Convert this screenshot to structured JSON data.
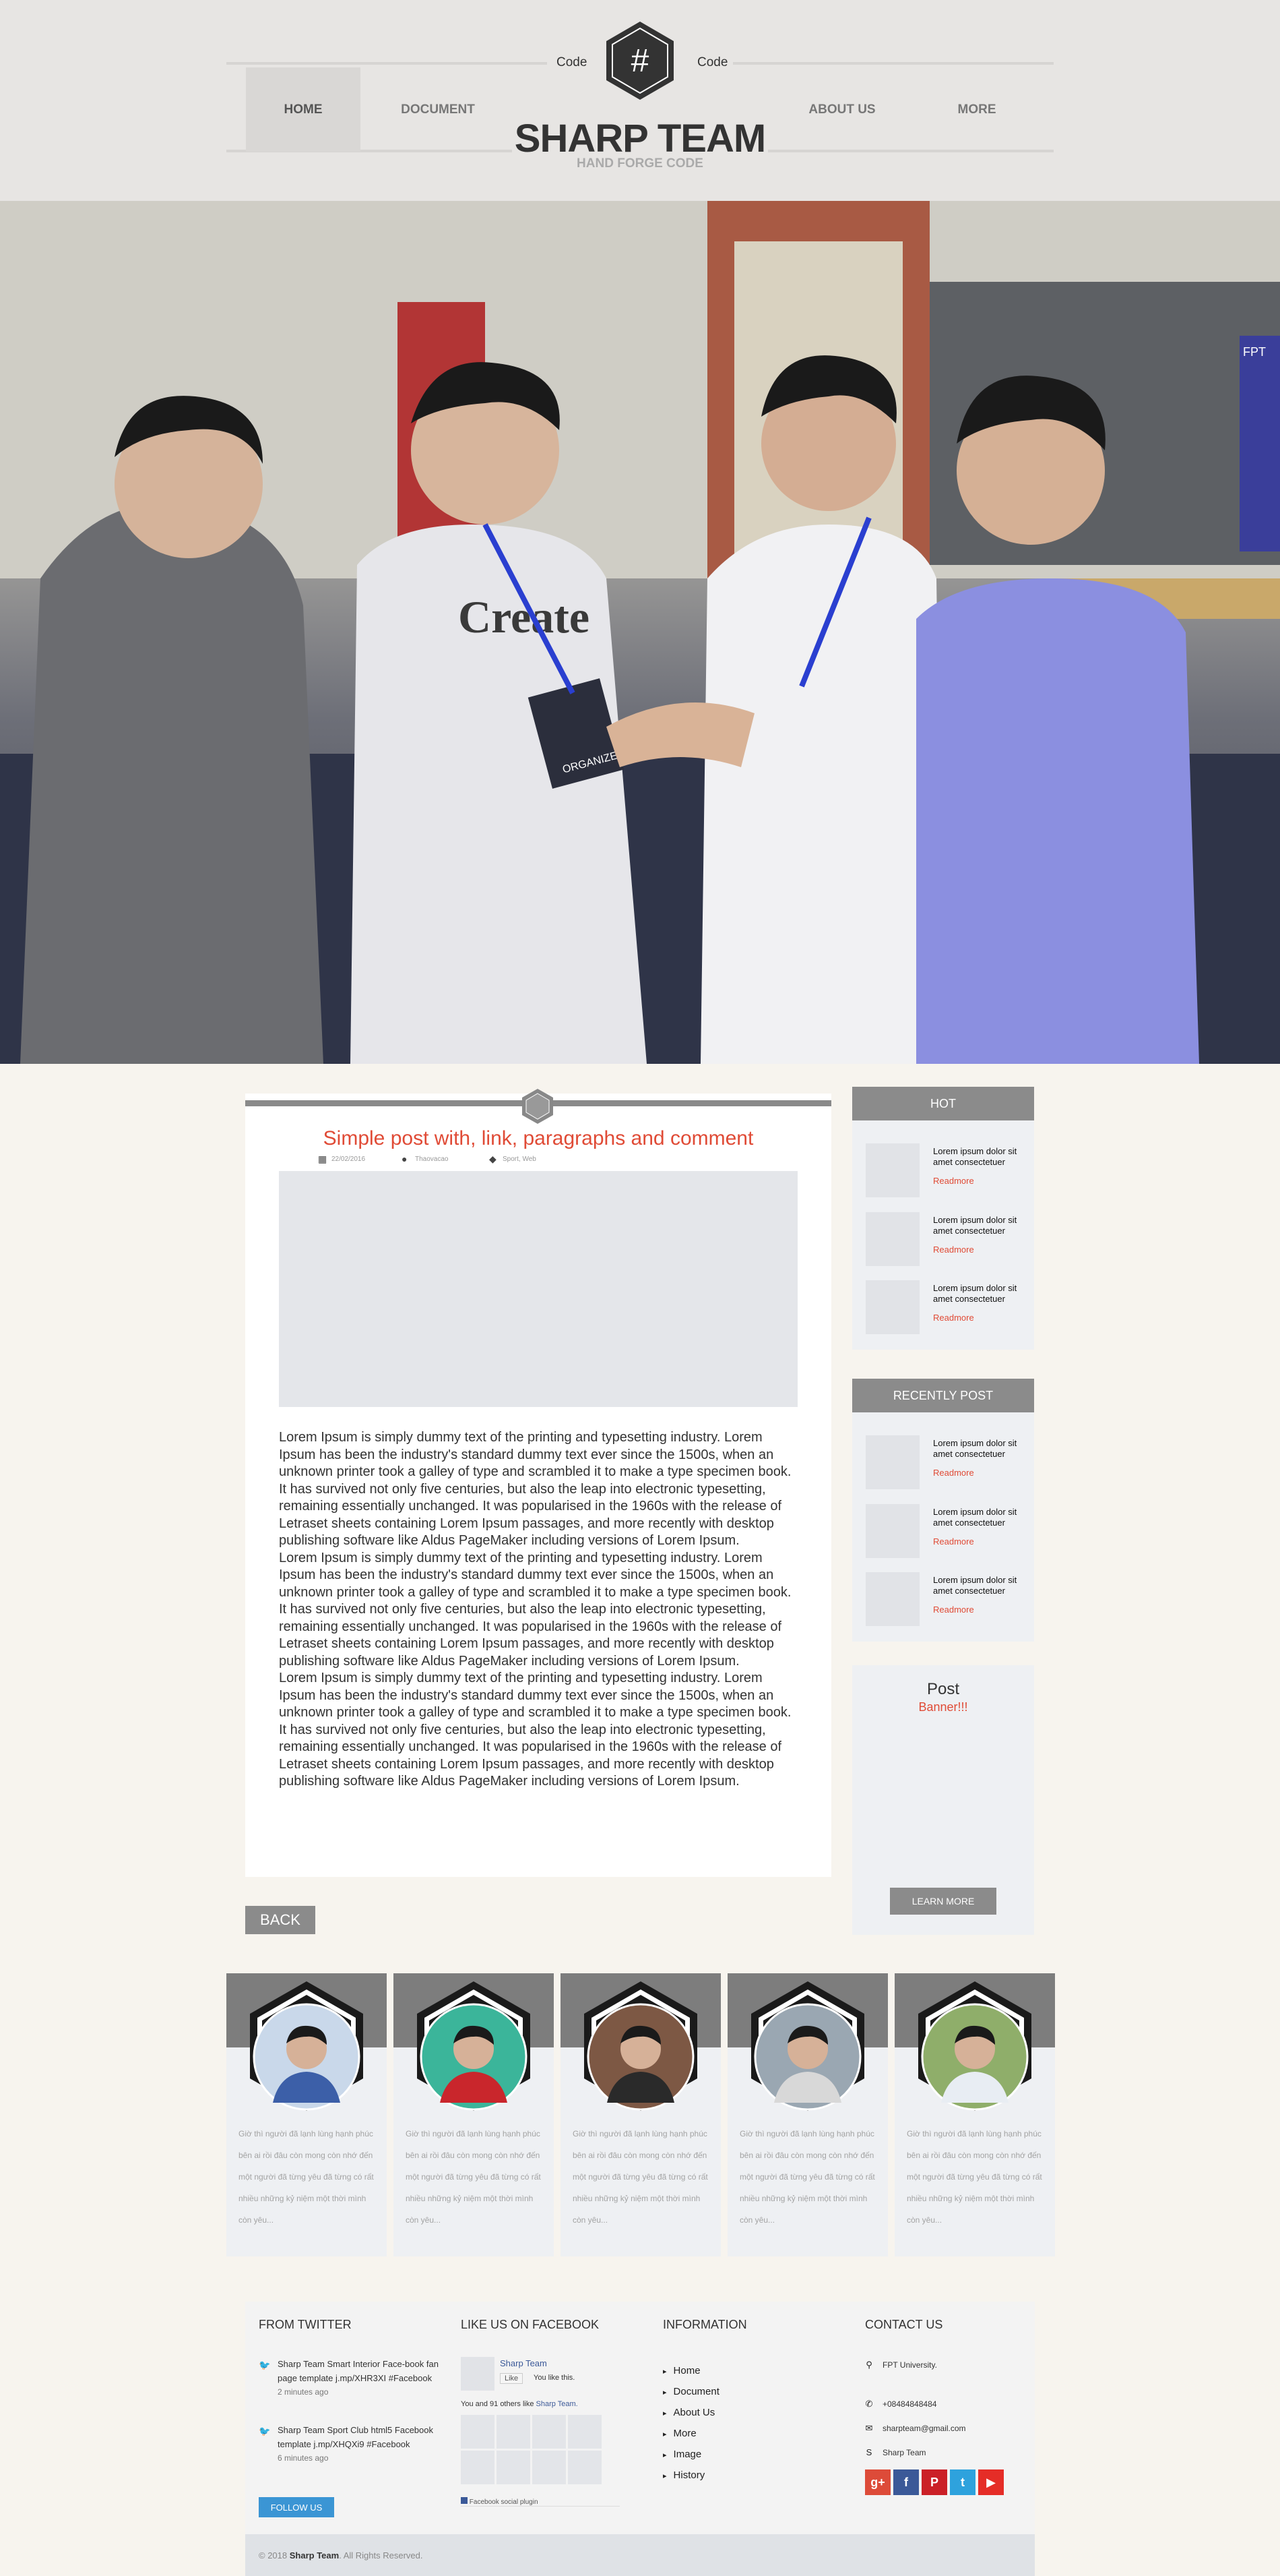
{
  "header": {
    "code_left": "Code",
    "code_right": "Code",
    "logo_symbol": "#",
    "brand": "SHARP TEAM",
    "tagline": "HAND FORGE CODE",
    "nav": [
      "HOME",
      "DOCUMENT",
      "ABOUT US",
      "MORE"
    ]
  },
  "hero": {
    "badge_text": "ORGANIZER",
    "shirt_text": "Create",
    "banner_text": "FPT",
    "slide_count": 3,
    "active_slide": 2
  },
  "post": {
    "title": "Simple post with, link,  paragraphs and comment",
    "date": "22/02/2016",
    "author": "Thaovacao",
    "tags": "Sport, Web",
    "paragraphs": [
      "Lorem Ipsum is simply dummy text of the printing and typesetting industry. Lorem Ipsum has been the industry's standard dummy text ever since the 1500s, when an unknown printer took a galley of type and scrambled it to make a type specimen book. It has survived not only five centuries, but also the leap into electronic typesetting, remaining essentially unchanged. It was popularised in the 1960s with the release of Letraset sheets containing Lorem Ipsum passages, and more recently with desktop publishing software like Aldus PageMaker including versions of Lorem Ipsum.",
      "Lorem Ipsum is simply dummy text of the printing and typesetting industry. Lorem Ipsum has been the industry's standard dummy text ever since the 1500s, when an unknown printer took a galley of type and scrambled it to make a type specimen book. It has survived not only five centuries, but also the leap into electronic typesetting, remaining essentially unchanged. It was popularised in the 1960s with the release of Letraset sheets containing Lorem Ipsum passages, and more recently with desktop publishing software like Aldus PageMaker including versions of Lorem Ipsum.",
      "Lorem Ipsum is simply dummy text of the printing and typesetting industry. Lorem Ipsum has been the industry's standard dummy text ever since the 1500s, when an unknown printer took a galley of type and scrambled it to make a type specimen book. It has survived not only five centuries, but also the leap into electronic typesetting, remaining essentially unchanged. It was popularised in the 1960s with the release of Letraset sheets containing Lorem Ipsum passages, and more recently with desktop publishing software like Aldus PageMaker including versions of Lorem Ipsum."
    ],
    "back_label": "BACK"
  },
  "sidebar": {
    "hot": {
      "title": "HOT",
      "items": [
        {
          "text": "Lorem ipsum dolor sit amet consectetuer",
          "more": "Readmore"
        },
        {
          "text": "Lorem ipsum dolor sit amet consectetuer",
          "more": "Readmore"
        },
        {
          "text": "Lorem ipsum dolor sit amet consectetuer",
          "more": "Readmore"
        }
      ]
    },
    "recent": {
      "title": "RECENTLY POST",
      "items": [
        {
          "text": "Lorem ipsum dolor sit amet consectetuer",
          "more": "Readmore"
        },
        {
          "text": "Lorem ipsum dolor sit amet consectetuer",
          "more": "Readmore"
        },
        {
          "text": "Lorem ipsum dolor sit amet consectetuer",
          "more": "Readmore"
        }
      ]
    },
    "ad": {
      "title": "Post",
      "subtitle": "Banner!!!",
      "button": "LEARN MORE"
    }
  },
  "team": {
    "members": [
      {
        "text": "Giờ thì người đã lạnh lùng hạnh phúc bên ai rồi đâu còn mong còn nhớ đến một người đã từng yêu đã từng có rất nhiều những kỷ niệm một thời mình còn yêu...",
        "shirt": "#3c5fa8",
        "bg": "#c9d8ea"
      },
      {
        "text": "Giờ thì người đã lạnh lùng hạnh phúc bên ai rồi đâu còn mong còn nhớ đến một người đã từng yêu đã từng có rất nhiều những kỷ niệm một thời mình còn yêu...",
        "shirt": "#c9262c",
        "bg": "#3bb59a"
      },
      {
        "text": "Giờ thì người đã lạnh lùng hạnh phúc bên ai rồi đâu còn mong còn nhớ đến một người đã từng yêu đã từng có rất nhiều những kỷ niệm một thời mình còn yêu...",
        "shirt": "#2a2a2a",
        "bg": "#7d5844"
      },
      {
        "text": "Giờ thì người đã lạnh lùng hạnh phúc bên ai rồi đâu còn mong còn nhớ đến một người đã từng yêu đã từng có rất nhiều những kỷ niệm một thời mình còn yêu...",
        "shirt": "#d8d8d8",
        "bg": "#9aa7b2"
      },
      {
        "text": "Giờ thì người đã lạnh lùng hạnh phúc bên ai rồi đâu còn mong còn nhớ đến một người đã từng yêu đã từng có rất nhiều những kỷ niệm một thời mình còn yêu...",
        "shirt": "#e8edf3",
        "bg": "#8fae6a"
      }
    ]
  },
  "footer": {
    "twitter": {
      "title": "FROM TWITTER",
      "tweets": [
        {
          "text": "Sharp Team Smart Interior Face-book fan page template j.mp/XHR3XI #Facebook",
          "ago": "2 minutes ago"
        },
        {
          "text": "Sharp Team Sport Club html5 Facebook template j.mp/XHQXi9 #Facebook",
          "ago": "6 minutes ago"
        }
      ],
      "follow": "FOLLOW US"
    },
    "facebook": {
      "title": "LIKE US ON FACEBOOK",
      "page": "Sharp Team",
      "like": "Like",
      "you_like": "You like this.",
      "others_prefix": "You and 91 others like",
      "others_page": "Sharp Team.",
      "plugin": "Facebook social plugin"
    },
    "info": {
      "title": "INFORMATION",
      "links": [
        "Home",
        "Document",
        "About Us",
        "More",
        "Image",
        "History"
      ]
    },
    "contact": {
      "title": "CONTACT US",
      "address": "FPT University.",
      "phone": "+08484848484",
      "email": "sharpteam@gmail.com",
      "skype": "Sharp Team"
    },
    "social_colors": {
      "google": "#dd4b39",
      "facebook": "#3b5998",
      "pinterest": "#cb2027",
      "twitter": "#2ea2dd",
      "youtube": "#e52d27"
    },
    "copyright_prefix": "© 2018",
    "copyright_brand": "Sharp Team",
    "copyright_suffix": ". All Rights Reserved."
  }
}
